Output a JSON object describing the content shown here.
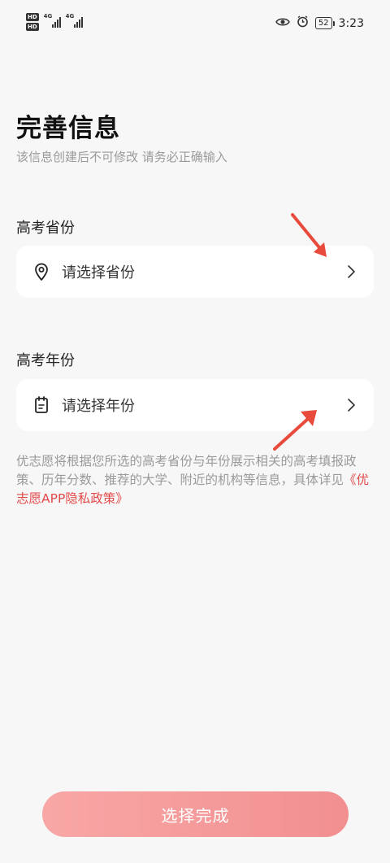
{
  "status_bar": {
    "hd_1": "HD",
    "hd_2": "HD",
    "net_1": "4G",
    "net_2": "4G",
    "battery": "52",
    "time": "3:23"
  },
  "header": {
    "title": "完善信息",
    "subtitle": "该信息创建后不可修改 请务必正确输入"
  },
  "province": {
    "label": "高考省份",
    "placeholder": "请选择省份",
    "icon": "location-pin-icon"
  },
  "year": {
    "label": "高考年份",
    "placeholder": "请选择年份",
    "icon": "calendar-icon"
  },
  "notice": {
    "text": "优志愿将根据您所选的高考省份与年份展示相关的高考填报政策、历年分数、推荐的大学、附近的机构等信息，具体详见",
    "link": "《优志愿APP隐私政策》"
  },
  "submit": {
    "label": "选择完成"
  },
  "colors": {
    "accent": "#e24a4a",
    "button_start": "#f8a7a6",
    "button_end": "#f28f90",
    "background": "#f7f7f7"
  }
}
